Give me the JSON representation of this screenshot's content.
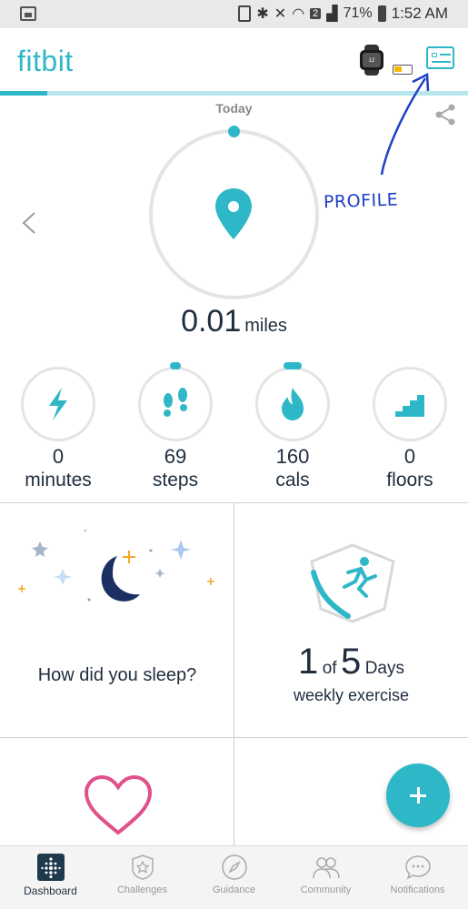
{
  "status_bar": {
    "battery_percent": "71%",
    "time": "1:52 AM",
    "badge": "2"
  },
  "app_bar": {
    "logo": "fitbit",
    "battery_level": 0.45,
    "sync_progress": 0.1
  },
  "hero": {
    "day_label": "Today",
    "value": "0.01",
    "unit": "miles"
  },
  "annotation": {
    "text": "PROFILE"
  },
  "stats": [
    {
      "value": "0",
      "label": "minutes",
      "icon": "bolt-icon"
    },
    {
      "value": "69",
      "label": "steps",
      "icon": "footprints-icon"
    },
    {
      "value": "160",
      "label": "cals",
      "icon": "flame-icon"
    },
    {
      "value": "0",
      "label": "floors",
      "icon": "stairs-icon"
    }
  ],
  "tiles": {
    "sleep": {
      "question": "How did you sleep?"
    },
    "exercise": {
      "count": "1",
      "of": "of",
      "total": "5",
      "unit": "Days",
      "subtitle": "weekly exercise"
    }
  },
  "bottom_nav": [
    {
      "label": "Dashboard",
      "icon": "dashboard-icon",
      "active": true
    },
    {
      "label": "Challenges",
      "icon": "star-badge-icon",
      "active": false
    },
    {
      "label": "Guidance",
      "icon": "compass-icon",
      "active": false
    },
    {
      "label": "Community",
      "icon": "people-icon",
      "active": false
    },
    {
      "label": "Notifications",
      "icon": "chat-bubble-icon",
      "active": false
    }
  ],
  "colors": {
    "accent": "#2eb8c7",
    "text": "#1f2d3d",
    "annotation": "#1e40c8",
    "sleep_moon": "#1b2f63",
    "heart": "#e0508a"
  }
}
